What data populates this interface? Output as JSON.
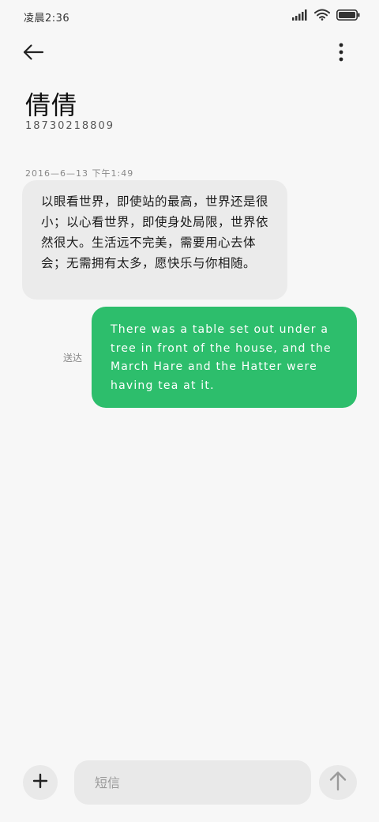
{
  "status_bar": {
    "time": "凌晨2:36",
    "icons": [
      "signal-icon",
      "wifi-icon",
      "battery-icon"
    ]
  },
  "header": {
    "back_icon": "back-arrow-icon",
    "more_icon": "more-vertical-icon",
    "contact_name": "倩倩",
    "contact_number": "18730218809"
  },
  "conversation": {
    "timestamp": "2016—6—13 下午1:49",
    "incoming": {
      "text": "以眼看世界，即使站的最高，世界还是很小；以心看世界，即使身处局限，世界依然很大。生活远不完美，需要用心去体会；无需拥有太多，愿快乐与你相随。"
    },
    "outgoing": {
      "text": "There was a table set out under a tree in front of the house, and the March Hare and the Hatter were having tea at it.",
      "status": "送达"
    }
  },
  "composer": {
    "add_icon": "plus-icon",
    "placeholder": "短信",
    "value": "",
    "send_icon": "send-arrow-icon"
  },
  "colors": {
    "background": "#f7f7f7",
    "incoming_bubble": "#ebebeb",
    "outgoing_bubble": "#2dbe6c",
    "button_bg": "#e9e9e9"
  }
}
